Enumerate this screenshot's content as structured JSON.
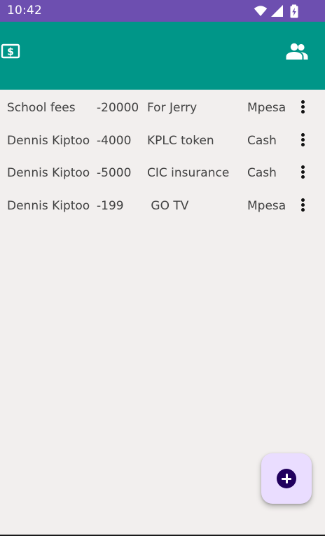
{
  "status_bar": {
    "time": "10:42",
    "icons": [
      "wifi-icon",
      "signal-icon",
      "battery-charging-icon"
    ]
  },
  "app_bar": {
    "left_icon": "money-icon",
    "right_icon": "people-icon"
  },
  "transactions": [
    {
      "name": "School fees",
      "amount": "-20000",
      "description": "For Jerry",
      "method": "Mpesa"
    },
    {
      "name": "Dennis Kiptoo",
      "amount": "-4000",
      "description": "KPLC token",
      "method": "Cash"
    },
    {
      "name": "Dennis Kiptoo",
      "amount": "-5000",
      "description": "CIC insurance",
      "method": "Cash"
    },
    {
      "name": "Dennis Kiptoo",
      "amount": "-199",
      "description": " GO TV",
      "method": "Mpesa"
    }
  ],
  "fab": {
    "icon": "add-icon"
  },
  "colors": {
    "status_bar": "#6d4fb0",
    "app_bar": "#009688",
    "background": "#f2efee",
    "fab": "#eaddff",
    "fab_icon": "#21005d",
    "text": "#424242"
  }
}
